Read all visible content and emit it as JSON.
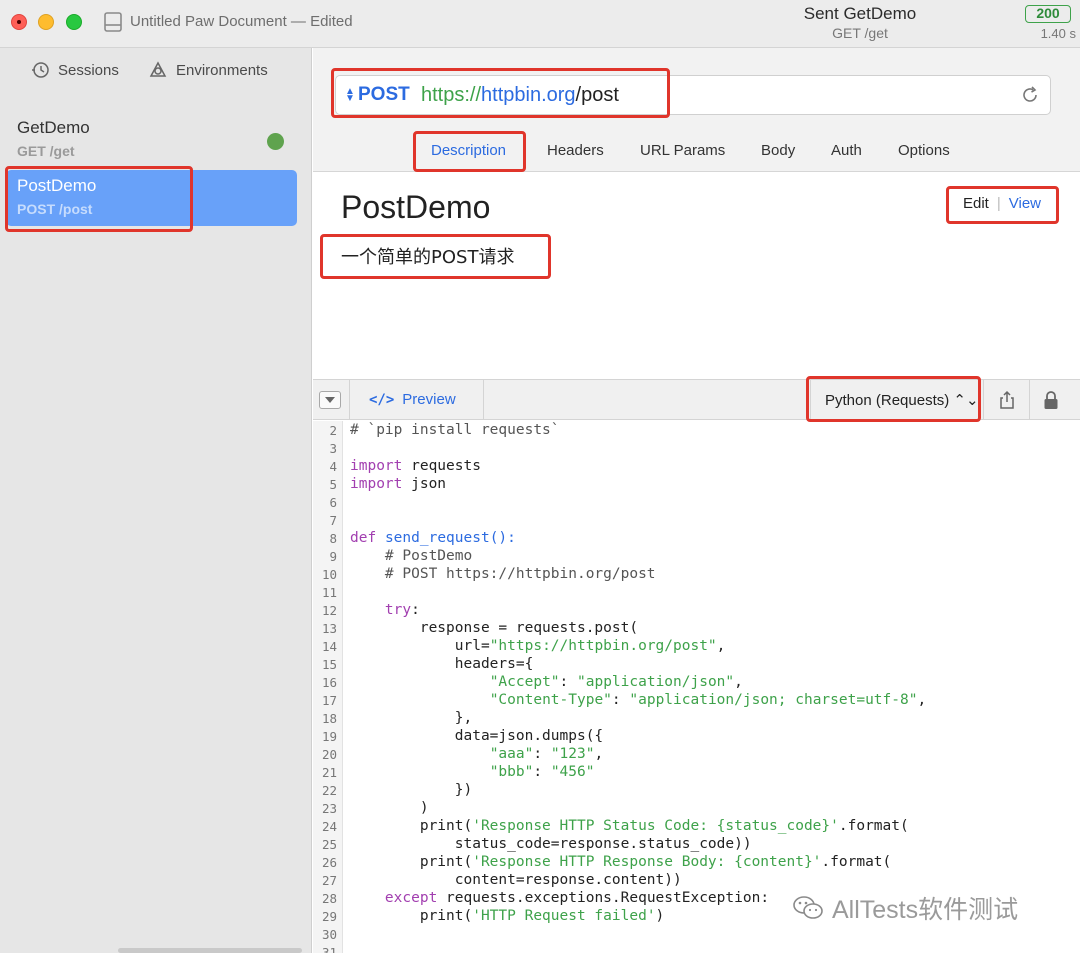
{
  "window": {
    "title": "Untitled Paw Document — Edited",
    "status": {
      "request_name": "Sent GetDemo",
      "request_path": "GET /get",
      "code": "200",
      "time": "1.40 s"
    }
  },
  "sidebar": {
    "tabs": [
      {
        "label": "Sessions",
        "icon": "history-icon"
      },
      {
        "label": "Environments",
        "icon": "environments-icon"
      }
    ],
    "requests": [
      {
        "name": "GetDemo",
        "path": "GET /get",
        "status_color": "#5fa34e"
      },
      {
        "name": "PostDemo",
        "path": "POST /post",
        "selected": true
      }
    ]
  },
  "request": {
    "method": "POST",
    "url": {
      "scheme": "https://",
      "host": "httpbin.org",
      "path": "/post"
    },
    "tabs": [
      {
        "label": "Description",
        "active": true
      },
      {
        "label": "Headers"
      },
      {
        "label": "URL Params"
      },
      {
        "label": "Body"
      },
      {
        "label": "Auth"
      },
      {
        "label": "Options"
      }
    ]
  },
  "description": {
    "title": "PostDemo",
    "text": "一个简单的POST请求",
    "edit_label": "Edit",
    "separator": "|",
    "view_label": "View"
  },
  "code_panel": {
    "preview_label": "Preview",
    "preview_glyph": "</>",
    "language": "Python (Requests) ⌃⌄",
    "lines": [
      {
        "n": "2",
        "text": "# `pip install requests`"
      },
      {
        "n": "3",
        "text": ""
      },
      {
        "n": "4",
        "text": "import requests"
      },
      {
        "n": "5",
        "text": "import json"
      },
      {
        "n": "6",
        "text": ""
      },
      {
        "n": "7",
        "text": ""
      },
      {
        "n": "8",
        "text": "def send_request():"
      },
      {
        "n": "9",
        "text": "    # PostDemo"
      },
      {
        "n": "10",
        "text": "    # POST https://httpbin.org/post"
      },
      {
        "n": "11",
        "text": ""
      },
      {
        "n": "12",
        "text": "    try:"
      },
      {
        "n": "13",
        "text": "        response = requests.post("
      },
      {
        "n": "14",
        "text": "            url=\"https://httpbin.org/post\","
      },
      {
        "n": "15",
        "text": "            headers={"
      },
      {
        "n": "16",
        "text": "                \"Accept\": \"application/json\","
      },
      {
        "n": "17",
        "text": "                \"Content-Type\": \"application/json; charset=utf-8\","
      },
      {
        "n": "18",
        "text": "            },"
      },
      {
        "n": "19",
        "text": "            data=json.dumps({"
      },
      {
        "n": "20",
        "text": "                \"aaa\": \"123\","
      },
      {
        "n": "21",
        "text": "                \"bbb\": \"456\""
      },
      {
        "n": "22",
        "text": "            })"
      },
      {
        "n": "23",
        "text": "        )"
      },
      {
        "n": "24",
        "text": "        print('Response HTTP Status Code: {status_code}'.format("
      },
      {
        "n": "25",
        "text": "            status_code=response.status_code))"
      },
      {
        "n": "26",
        "text": "        print('Response HTTP Response Body: {content}'.format("
      },
      {
        "n": "27",
        "text": "            content=response.content))"
      },
      {
        "n": "28",
        "text": "    except requests.exceptions.RequestException:"
      },
      {
        "n": "29",
        "text": "        print('HTTP Request failed')"
      },
      {
        "n": "30",
        "text": ""
      },
      {
        "n": "31",
        "text": ""
      }
    ]
  },
  "watermark": "AllTests软件测试",
  "colors": {
    "accent": "#2c6be0",
    "string": "#3ea24a",
    "keyword": "#a23fb0",
    "highlight": "#e0352b",
    "selection": "#68a1f9"
  }
}
